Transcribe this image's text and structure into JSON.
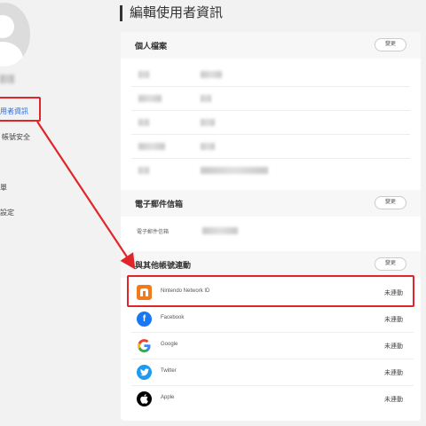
{
  "header": {
    "title": "編輯使用者資訊"
  },
  "sidebar": {
    "items": [
      {
        "label": "使用者資訊"
      },
      {
        "label": "帳號安全"
      },
      {
        "label": "單"
      },
      {
        "label": "設定"
      }
    ]
  },
  "profile": {
    "title": "個人檔案",
    "change_label": "變更"
  },
  "email": {
    "title": "電子郵件信箱",
    "change_label": "變更",
    "field_label": "電子郵件信箱"
  },
  "linked": {
    "title": "與其他帳號連動",
    "change_label": "變更",
    "accounts": [
      {
        "name": "Nintendo Network ID",
        "status": "未連動",
        "color": "#f07a1c"
      },
      {
        "name": "Facebook",
        "status": "未連動",
        "color": "#1877f2"
      },
      {
        "name": "Google",
        "status": "未連動",
        "color": "#4285f4"
      },
      {
        "name": "Twitter",
        "status": "未連動",
        "color": "#1d9bf0"
      },
      {
        "name": "Apple",
        "status": "未連動",
        "color": "#000000"
      }
    ]
  },
  "accent": {
    "highlight": "#e0262b",
    "link": "#2f6fdb"
  }
}
